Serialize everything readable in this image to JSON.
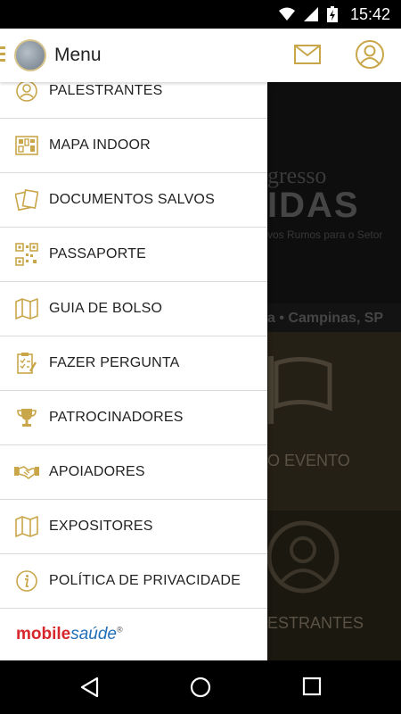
{
  "status_bar": {
    "time": "15:42"
  },
  "app_bar": {
    "title": "Menu"
  },
  "background": {
    "banner_line1": "gresso",
    "banner_line2": "IDAS",
    "banner_line3": "vos Rumos para o Setor",
    "location": "a • Campinas, SP",
    "tile1_label": "O EVENTO",
    "tile2_label": "ESTRANTES"
  },
  "menu": {
    "items": [
      {
        "label": "PALESTRANTES",
        "icon": "speaker-icon"
      },
      {
        "label": "MAPA INDOOR",
        "icon": "map-indoor-icon"
      },
      {
        "label": "DOCUMENTOS SALVOS",
        "icon": "documents-icon"
      },
      {
        "label": "PASSAPORTE",
        "icon": "qr-code-icon"
      },
      {
        "label": "GUIA DE BOLSO",
        "icon": "folded-map-icon"
      },
      {
        "label": "FAZER PERGUNTA",
        "icon": "clipboard-icon"
      },
      {
        "label": "PATROCINADORES",
        "icon": "trophy-icon"
      },
      {
        "label": "APOIADORES",
        "icon": "handshake-icon"
      },
      {
        "label": "EXPOSITORES",
        "icon": "folded-map-icon"
      },
      {
        "label": "POLÍTICA DE PRIVACIDADE",
        "icon": "info-icon"
      }
    ]
  },
  "brand": {
    "part1": "mobile",
    "part2": "saúde",
    "mark": "®"
  },
  "colors": {
    "accent": "#c9a64a",
    "brand_red": "#d7262c",
    "brand_blue": "#1e6fb8"
  }
}
